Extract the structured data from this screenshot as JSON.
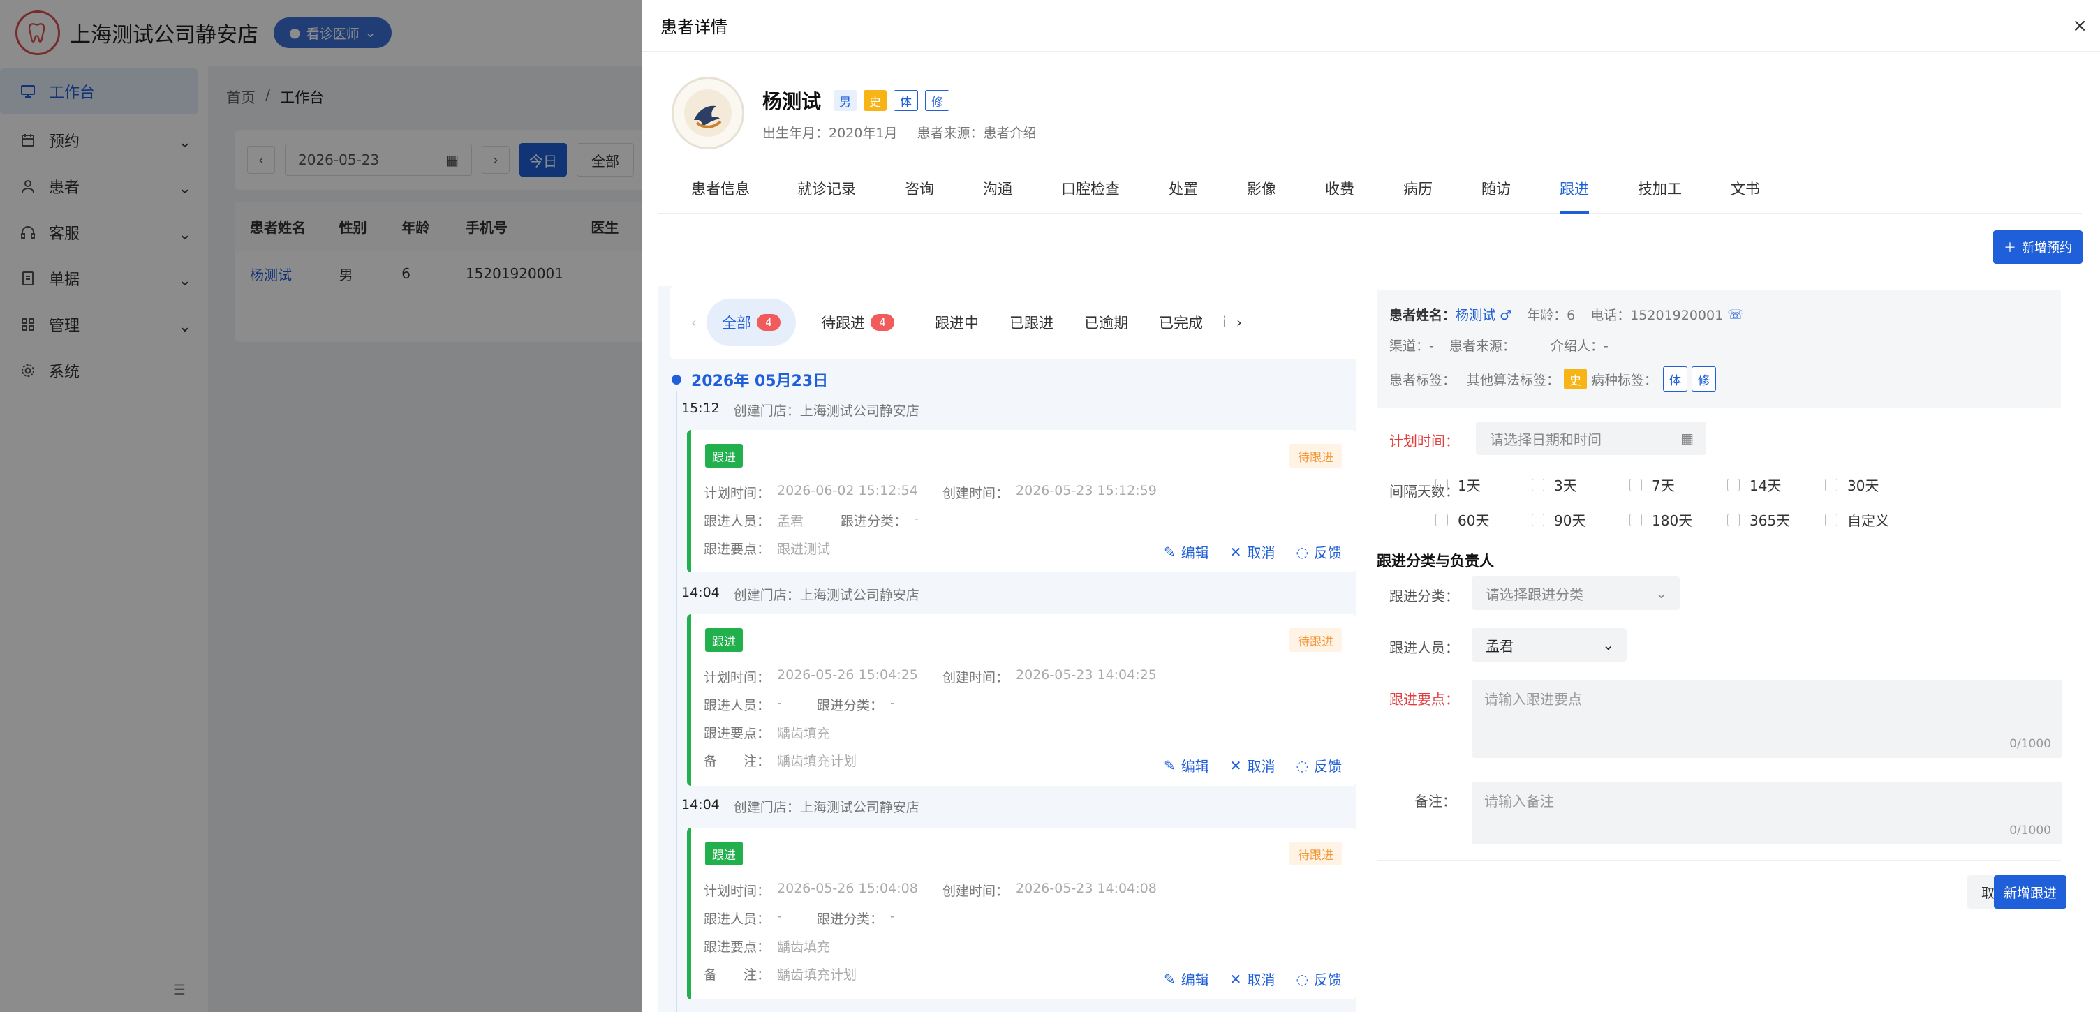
{
  "app": {
    "name": "上海测试公司静安店",
    "role_button": "看诊医师"
  },
  "sidebar": {
    "items": [
      {
        "label": "工作台",
        "icon": "desktop-icon"
      },
      {
        "label": "预约",
        "icon": "calendar-icon"
      },
      {
        "label": "患者",
        "icon": "user-icon"
      },
      {
        "label": "客服",
        "icon": "headset-icon"
      },
      {
        "label": "单据",
        "icon": "document-icon"
      },
      {
        "label": "管理",
        "icon": "grid-icon"
      },
      {
        "label": "系统",
        "icon": "gear-icon"
      }
    ]
  },
  "workbench": {
    "breadcrumb": [
      "首页",
      "/",
      "工作台"
    ],
    "date": "2026-05-23",
    "today_label": "今日",
    "all_label": "全部",
    "table": {
      "columns": [
        "患者姓名",
        "性别",
        "年龄",
        "手机号",
        "医生"
      ],
      "rows": [
        [
          "杨测试",
          "男",
          "6",
          "15201920001",
          ""
        ]
      ]
    }
  },
  "drawer": {
    "title": "患者详情",
    "close": "×",
    "patient": {
      "name": "杨测试",
      "gender_tag": "男",
      "tags": [
        "史",
        "体",
        "修"
      ],
      "birth": "出生年月：2020年1月",
      "source": "患者来源：患者介绍"
    },
    "tabs": [
      "患者信息",
      "就诊记录",
      "咨询",
      "沟通",
      "口腔检查",
      "处置",
      "影像",
      "收费",
      "病历",
      "随访",
      "跟进",
      "技加工",
      "文书"
    ],
    "active_tab": "跟进",
    "new_appointment": "新增预约"
  },
  "followup_list": {
    "filter_tabs": [
      {
        "label": "全部",
        "count": "4"
      },
      {
        "label": "待跟进",
        "count": "4"
      },
      {
        "label": "跟进中",
        "count": ""
      },
      {
        "label": "已跟进",
        "count": ""
      },
      {
        "label": "已逾期",
        "count": ""
      },
      {
        "label": "已完成",
        "count": ""
      },
      {
        "label": "i",
        "count": ""
      }
    ],
    "date_heading": "2026年 05月23日",
    "entries": [
      {
        "time": "15:12",
        "store": "创建门店：上海测试公司静安店",
        "type_tag": "跟进",
        "status": "待跟进",
        "plan_label": "计划时间：",
        "plan": "2026-06-02 15:12:54",
        "created_label": "创建时间：",
        "created": "2026-05-23 15:12:59",
        "person_label": "跟进人员：",
        "person": "孟君",
        "category_label": "跟进分类：",
        "category": "-",
        "points_label": "跟进要点：",
        "points": "跟进测试",
        "remark_label": "",
        "remark": ""
      },
      {
        "time": "14:04",
        "store": "创建门店：上海测试公司静安店",
        "type_tag": "跟进",
        "status": "待跟进",
        "plan_label": "计划时间：",
        "plan": "2026-05-26 15:04:25",
        "created_label": "创建时间：",
        "created": "2026-05-23 14:04:25",
        "person_label": "跟进人员：",
        "person": "-",
        "category_label": "跟进分类：",
        "category": "-",
        "points_label": "跟进要点：",
        "points": "龋齿填充",
        "remark_label": "备　　注：",
        "remark": "龋齿填充计划"
      },
      {
        "time": "14:04",
        "store": "创建门店：上海测试公司静安店",
        "type_tag": "跟进",
        "status": "待跟进",
        "plan_label": "计划时间：",
        "plan": "2026-05-26 15:04:08",
        "created_label": "创建时间：",
        "created": "2026-05-23 14:04:08",
        "person_label": "跟进人员：",
        "person": "-",
        "category_label": "跟进分类：",
        "category": "-",
        "points_label": "跟进要点：",
        "points": "龋齿填充",
        "remark_label": "备　　注：",
        "remark": "龋齿填充计划"
      }
    ],
    "actions": {
      "edit": "编辑",
      "cancel": "取消",
      "feedback": "反馈"
    }
  },
  "followup_form": {
    "info": {
      "name_label": "患者姓名：",
      "name": "杨测试",
      "age": "年龄：6",
      "phone": "电话：15201920001",
      "channel": "渠道：-",
      "source": "患者来源：",
      "referrer": "介绍人：-",
      "tags_label": "患者标签：",
      "algo_label": "其他算法标签：",
      "algo_tag": "史",
      "disease_label": "病种标签：",
      "disease_tags": [
        "体",
        "修"
      ]
    },
    "plan_time_label": "计划时间：",
    "plan_time_placeholder": "请选择日期和时间",
    "interval_label": "间隔天数：",
    "intervals": [
      "1天",
      "3天",
      "7天",
      "14天",
      "30天",
      "60天",
      "90天",
      "180天",
      "365天",
      "自定义"
    ],
    "section_title": "跟进分类与负责人",
    "category_label": "跟进分类：",
    "category_placeholder": "请选择跟进分类",
    "person_label": "跟进人员：",
    "person_value": "孟君",
    "points_label": "跟进要点：",
    "points_placeholder": "请输入跟进要点",
    "points_counter": "0/1000",
    "remark_label": "备注：",
    "remark_placeholder": "请输入备注",
    "remark_counter": "0/1000",
    "cancel": "取消",
    "submit": "新增跟进"
  }
}
